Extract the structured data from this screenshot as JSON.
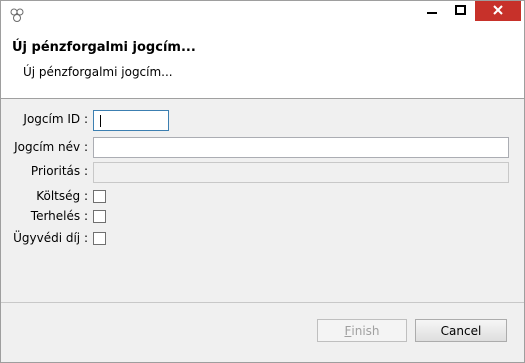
{
  "header": {
    "title": "Új pénzforgalmi jogcím...",
    "description": "Új pénzforgalmi jogcím..."
  },
  "form": {
    "jogcim_id_label": "Jogcím ID :",
    "jogcim_id_value": "",
    "jogcim_nev_label": "Jogcím név :",
    "jogcim_nev_value": "",
    "prioritas_label": "Prioritás :",
    "prioritas_value": "",
    "koltseg_label": "Költség :",
    "koltseg_checked": false,
    "terheles_label": "Terhelés :",
    "terheles_checked": false,
    "ugyvedi_dij_label": "Ügyvédi díj :",
    "ugyvedi_dij_checked": false
  },
  "buttons": {
    "finish_mnemonic": "F",
    "finish_rest": "inish",
    "cancel_label": "Cancel"
  },
  "icons": {
    "app": "app-icon",
    "minimize": "minimize-icon",
    "maximize": "maximize-icon",
    "close": "close-icon"
  },
  "colors": {
    "close_button": "#c7312a",
    "focus_border": "#3c7fb1",
    "disabled_text": "#a0a0a0"
  }
}
